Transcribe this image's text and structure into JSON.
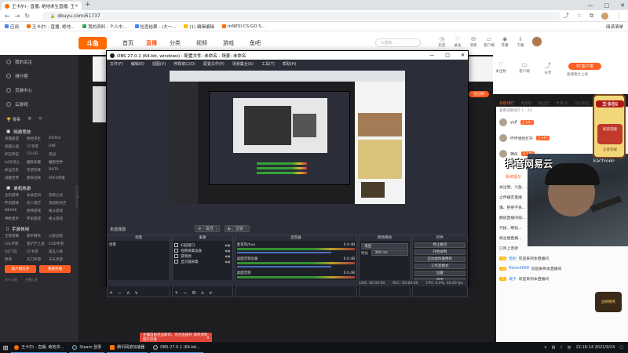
{
  "browser": {
    "tab_title": "王卡尔i - 直播, 绝地求生直播, 王卡...",
    "tab_close": "×",
    "new_tab": "+",
    "url": "douyu.com/61737",
    "min_glyph": "—",
    "max_glyph": "□",
    "close_glyph": "✕",
    "bookmarks": [
      {
        "label": "应用",
        "color": "#4285f4"
      },
      {
        "label": "王卡尔i - 直播, 绝地...",
        "color": "#ff6c00"
      },
      {
        "label": "我的资料 - 个人中...",
        "color": "#34a853"
      },
      {
        "label": "检查结果 - (大一...",
        "color": "#4285f4"
      },
      {
        "label": "(1) 编辑编辑",
        "color": "#fbbc05"
      },
      {
        "label": "mNESI CS:GO S...",
        "color": "#ff6c00"
      }
    ],
    "reading_list": "阅读清单"
  },
  "site": {
    "logo": "斗鱼",
    "nav": [
      "首页",
      "直播",
      "分类",
      "视频",
      "游戏",
      "鱼吧"
    ],
    "search_placeholder": "火箭车",
    "header_icons": [
      "历史",
      "关注",
      "消息",
      "客户端",
      "开播",
      "下载"
    ]
  },
  "sidebar": {
    "top_items": [
      "我的关注",
      "排行榜",
      "页游中心",
      "云游戏"
    ],
    "icon_row": [
      "赛事",
      "",
      ""
    ],
    "sections": [
      {
        "title": "网游竞技",
        "items": [
          "英雄联盟",
          "绝地求生",
          "DOTA2",
          "穿越火道",
          "CF手游",
          "DNF",
          "炉石传说",
          "CS:GO",
          "逆战",
          "lol云顶之...",
          "魔兽争霸",
          "魔兽世界",
          "命运方舟",
          "守望先锋",
          "DOTA",
          "战舰世界",
          "使命召唤",
          "APEX英雄"
        ]
      },
      {
        "title": "单机热游",
        "items": [
          "主机游戏",
          "永劫无间",
          "恐怖之间",
          "怀旧游戏",
          "双人成行",
          "消逝的光芒",
          "NBA2K",
          "原神游戏",
          "格斗游戏",
          "神枪猎手",
          "怀旧游戏",
          "格斗游戏"
        ]
      },
      {
        "title": "手游休闲",
        "items": [
          "王者荣耀",
          "和平精英",
          "火影忍者",
          "LOL手游",
          "金铲铲之战",
          "COD手游",
          "QQ飞车",
          "CF手游",
          "第五人格",
          "原神",
          "天刀手游",
          "天天手游"
        ]
      }
    ],
    "btn_client": "客户端打开",
    "btn_live": "我要开播",
    "foot": [
      "关于斗鱼",
      "主播入驻"
    ]
  },
  "right": {
    "icons": [
      "关注数",
      "客户端",
      "分享"
    ],
    "pc_btn": "PC客户端",
    "pc_sub": "直播看片上线",
    "orange_pill": "已订阅",
    "rank_tabs": [
      "贡献排行",
      "周榜前",
      "粉丝团",
      "贵宾(1)",
      "钻石粉丝"
    ],
    "rank_note": "查看贡献排行 1 - 24",
    "rank": [
      {
        "name": "yyjf",
        "lv": "王卡尔i"
      },
      {
        "name": "哼哼哈哈打开",
        "lv": "王卡尔i"
      },
      {
        "name": "神舟",
        "lv": "王卡尔i"
      }
    ],
    "sys_tip": "系统提示",
    "chat": [
      {
        "badge": "",
        "nick": "",
        "text": "关注我、斗鱼、..."
      },
      {
        "badge": "",
        "nick": "",
        "text": "止伴播友直播"
      },
      {
        "badge": "",
        "nick": "",
        "text": "慎、拒绝不良..."
      },
      {
        "badge": "",
        "nick": "",
        "text": "翻说直播间视..."
      },
      {
        "badge": "",
        "nick": "",
        "text": "代投、刷钻..."
      },
      {
        "badge": "",
        "nick": "",
        "text": "如主播直播..."
      },
      {
        "badge": "",
        "nick": "",
        "text": "口吊上走牌"
      },
      {
        "badge": "16",
        "nick": "猎豹",
        "text": "欢迎来到本直播间"
      },
      {
        "badge": "13",
        "nick": "Tokon4668",
        "text": "欢迎来到本直播间"
      },
      {
        "badge": "11",
        "nick": "城子",
        "text": "欢迎来到本直播间"
      }
    ],
    "wm_text": "抖音网易云",
    "wm_right": "kachioeo",
    "gift_title": "王卡尔i",
    "gift_body": "初恋无敌",
    "gift_foot": "王者荣耀",
    "bottom_badge": "战将精英"
  },
  "toast": {
    "text": "主播自由点击即可、可点击提升 请勿对你提示开发",
    "close": "×"
  },
  "obs": {
    "title": "OBS 27.0.1 (64-bit, windows) - 配置文件: 未命名 - 场景: 未命名",
    "menu": [
      "文件(F)",
      "编辑(E)",
      "视图(V)",
      "停靠窗口(D)",
      "配置文件(P)",
      "场景集合(S)",
      "工具(T)",
      "帮助(H)"
    ],
    "no_source": "未选择源",
    "prop_btn": "属性",
    "filter_btn": "滤镜",
    "docks": {
      "scenes": {
        "title": "场景",
        "items": [
          "场景"
        ]
      },
      "sources": {
        "title": "来源",
        "items": [
          "扫描窗口",
          "视频采集设备",
          "游戏源",
          "显示器采集"
        ]
      },
      "mixer": {
        "title": "混音器",
        "rows": [
          {
            "name": "麦克风/Aux",
            "db": "0.0 dB"
          },
          {
            "name": "桌面音频设备",
            "db": "0.0 dB"
          },
          {
            "name": "桌面音频",
            "db": "0.0 dB"
          }
        ]
      },
      "transitions": {
        "title": "转场特效",
        "type": "渐变",
        "duration_label": "时长",
        "duration": "300 ms"
      },
      "controls": {
        "title": "控件",
        "buttons": [
          "停止推流",
          "开始录制",
          "启动虚拟摄像机",
          "工作室模式",
          "设置",
          "退出"
        ]
      }
    },
    "status": [
      "LIVE: 00:00:00",
      "REC: 00:00:00",
      "CPU: 0.0%, 60.00 fps"
    ]
  },
  "taskbar": {
    "apps": [
      {
        "label": "王卡尔i - 直播, 绝地求...",
        "kind": "chrome"
      },
      {
        "label": "Steam 登录",
        "kind": "steam"
      },
      {
        "label": "腾讯网游加速器",
        "kind": "qq"
      },
      {
        "label": "OBS 27.0.1 (64-bit...",
        "kind": "obs"
      }
    ],
    "time": "22:16:14",
    "date": "2021/9/24",
    "lang": "中"
  }
}
